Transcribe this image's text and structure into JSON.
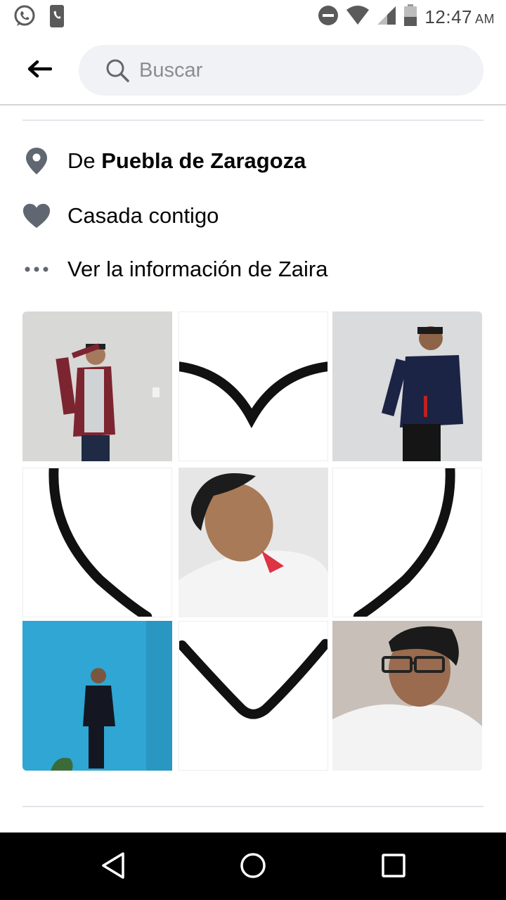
{
  "status_bar": {
    "time": "12:47",
    "ampm": "AM",
    "left_icons": [
      "whatsapp-icon",
      "phone-notification-icon"
    ],
    "right_icons": [
      "do-not-disturb-icon",
      "wifi-icon",
      "cell-signal-icon",
      "battery-icon"
    ]
  },
  "header": {
    "back_icon": "back-arrow-icon",
    "search": {
      "placeholder": "Buscar",
      "icon": "search-icon"
    }
  },
  "profile_info": {
    "location": {
      "prefix": "De ",
      "value": "Puebla de Zaragoza",
      "icon": "location-pin-icon"
    },
    "relationship": {
      "label": "Casada contigo",
      "icon": "heart-icon"
    },
    "more": {
      "label": "Ver la información de Zaira",
      "icon": "more-dots-icon"
    }
  },
  "photos": [
    {
      "name": "photo-1",
      "kind": "person-saluting"
    },
    {
      "name": "photo-2",
      "kind": "heart-piece-top"
    },
    {
      "name": "photo-3",
      "kind": "person-standing"
    },
    {
      "name": "photo-4",
      "kind": "heart-piece-left"
    },
    {
      "name": "photo-5",
      "kind": "selfie-smiling"
    },
    {
      "name": "photo-6",
      "kind": "heart-piece-right"
    },
    {
      "name": "photo-7",
      "kind": "person-blue-wall"
    },
    {
      "name": "photo-8",
      "kind": "heart-piece-bottom"
    },
    {
      "name": "photo-9",
      "kind": "selfie-glasses"
    }
  ],
  "nav_bar": {
    "icons": [
      "nav-back-icon",
      "nav-home-icon",
      "nav-recents-icon"
    ]
  },
  "colors": {
    "icon_gray": "#606770",
    "search_bg": "#f0f2f5",
    "divider": "#e4e6eb",
    "text": "#050505"
  }
}
